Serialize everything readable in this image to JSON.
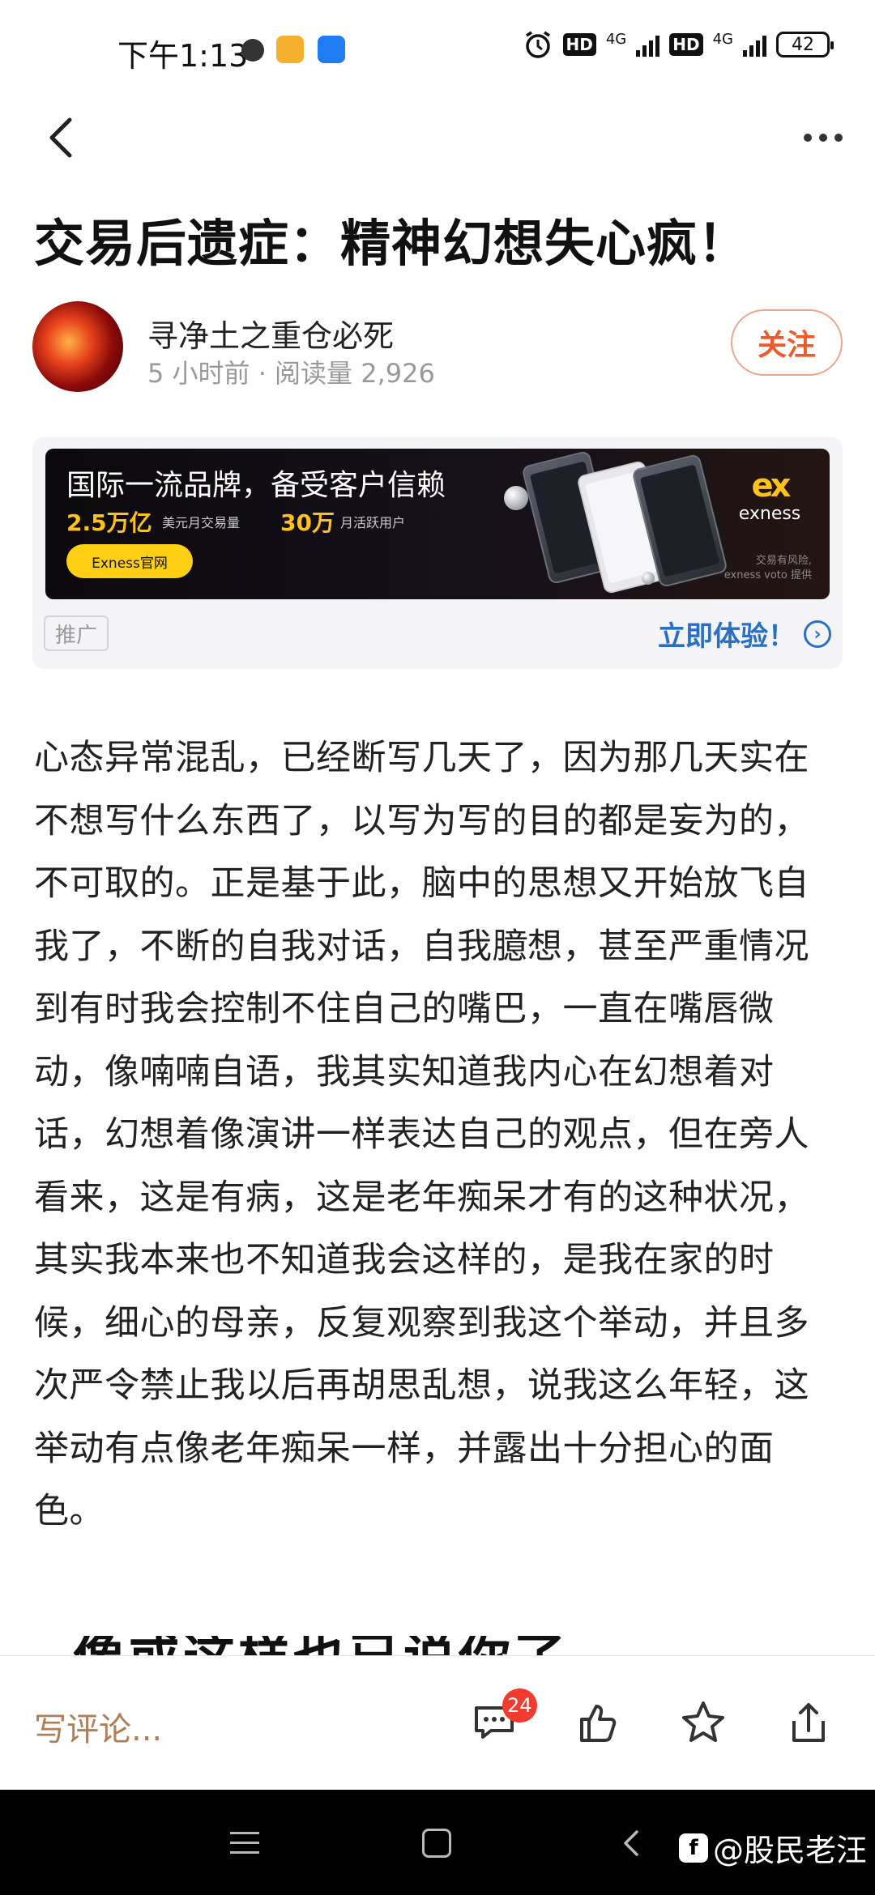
{
  "status_bar": {
    "time": "下午1:13",
    "network1": "4G",
    "network2": "4G",
    "hd": "HD",
    "battery": "42"
  },
  "article": {
    "title": "交易后遗症：精神幻想失心疯！",
    "author_name": "寻净土之重仓必死",
    "meta": "5 小时前 · 阅读量 2,926",
    "follow_label": "关注",
    "body": "心态异常混乱，已经断写几天了，因为那几天实在不想写什么东西了，以写为写的目的都是妄为的，不可取的。正是基于此，脑中的思想又开始放飞自我了，不断的自我对话，自我臆想，甚至严重情况到有时我会控制不住自己的嘴巴，一直在嘴唇微动，像喃喃自语，我其实知道我内心在幻想着对话，幻想着像演讲一样表达自己的观点，但在旁人看来，这是有病，这是老年痴呆才有的这种状况，其实我本来也不知道我会这样的，是我在家的时候，细心的母亲，反复观察到我这个举动，并且多次严令禁止我以后再胡思乱想，说我这么年轻，这举动有点像老年痴呆一样，并露出十分担心的面色。",
    "cutoff_heading": "像或这样也已说你了"
  },
  "ad": {
    "headline": "国际一流品牌，备受客户信赖",
    "stat1_value": "2.5万亿",
    "stat1_label": "美元月交易量",
    "stat2_value": "30万",
    "stat2_label": "月活跃用户",
    "cta": "Exness官网",
    "brand": "exness",
    "brand_mark": "ex",
    "disclaimer_line1": "交易有风险,",
    "disclaimer_line2": "exness voto 提供",
    "tag": "推广",
    "try_label": "立即体验！"
  },
  "bottom_bar": {
    "comment_placeholder": "写评论...",
    "comment_count": "24"
  },
  "watermark": {
    "text": "@股民老汪",
    "logo": "f"
  },
  "colors": {
    "follow": "#ef5a2a",
    "ad_accent": "#ffc21a",
    "link_blue": "#2b6fc4",
    "badge_red": "#f23a2e"
  }
}
